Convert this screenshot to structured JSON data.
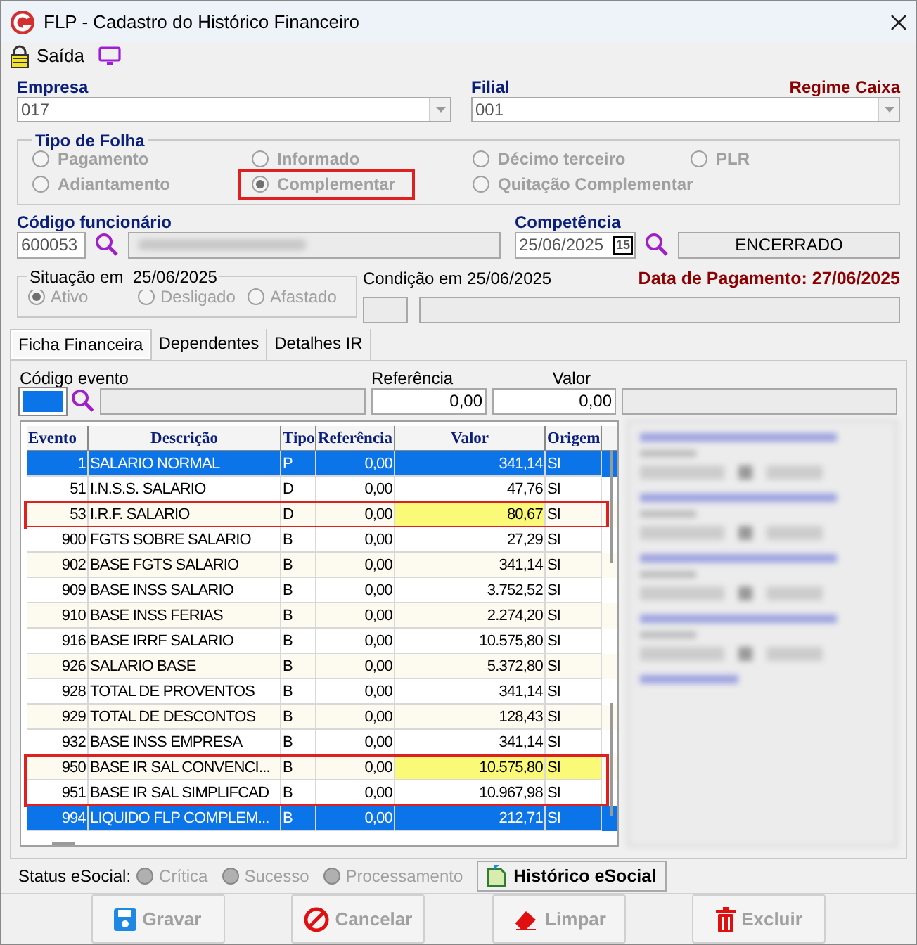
{
  "window": {
    "title": "FLP - Cadastro do Histórico Financeiro"
  },
  "toolbar": [
    {
      "kind": "lock",
      "label": "Saída"
    },
    {
      "kind": "monitor"
    }
  ],
  "empresa": {
    "label": "Empresa",
    "value": "017"
  },
  "filial": {
    "label": "Filial",
    "value": "001"
  },
  "regime": "Regime Caixa",
  "tipo_folha": {
    "title": "Tipo de Folha",
    "options": [
      {
        "label": "Pagamento",
        "selected": false,
        "outlined": false
      },
      {
        "label": "Informado",
        "selected": false,
        "outlined": false
      },
      {
        "label": "Décimo terceiro",
        "selected": false,
        "outlined": false
      },
      {
        "label": "PLR",
        "selected": false,
        "outlined": false
      },
      {
        "label": "Adiantamento",
        "selected": false,
        "outlined": false
      },
      {
        "label": "Complementar",
        "selected": true,
        "outlined": true
      },
      {
        "label": "Quitação Complementar",
        "selected": false,
        "outlined": false
      }
    ]
  },
  "funcionario": {
    "label": "Código funcionário",
    "code": "600053"
  },
  "competencia": {
    "label": "Competência",
    "value": "25/06/2025",
    "calendar": "15",
    "status": "ENCERRADO"
  },
  "situacao": {
    "title": "Situação em  25/06/2025",
    "options": [
      {
        "label": "Ativo",
        "selected": true
      },
      {
        "label": "Desligado",
        "selected": false
      },
      {
        "label": "Afastado",
        "selected": false
      }
    ]
  },
  "condicao": {
    "label": "Condição em 25/06/2025"
  },
  "pagamento": "Data de Pagamento: 27/06/2025",
  "tabs": [
    {
      "label": "Ficha Financeira",
      "selected": true
    },
    {
      "label": "Dependentes",
      "selected": false
    },
    {
      "label": "Detalhes IR",
      "selected": false
    }
  ],
  "evento": {
    "codigo_label": "Código evento",
    "referencia_label": "Referência",
    "referencia": "0,00",
    "valor_label": "Valor",
    "valor": "0,00"
  },
  "table": {
    "columns": [
      "Evento",
      "Descrição",
      "Tipo",
      "Referência",
      "Valor",
      "Origem"
    ],
    "rows": [
      {
        "cells": [
          "1",
          "SALARIO NORMAL",
          "P",
          "0,00",
          "341,14",
          "SI"
        ],
        "selected": true,
        "valor_highlighted": false,
        "origem_highlighted": false,
        "outlined": false
      },
      {
        "cells": [
          "51",
          "I.N.S.S. SALARIO",
          "D",
          "0,00",
          "47,76",
          "SI"
        ],
        "selected": false,
        "valor_highlighted": false,
        "origem_highlighted": false,
        "outlined": false
      },
      {
        "cells": [
          "53",
          "I.R.F. SALARIO",
          "D",
          "0,00",
          "80,67",
          "SI"
        ],
        "selected": false,
        "valor_highlighted": true,
        "origem_highlighted": false,
        "outlined": true
      },
      {
        "cells": [
          "900",
          "FGTS SOBRE SALARIO",
          "B",
          "0,00",
          "27,29",
          "SI"
        ],
        "selected": false,
        "valor_highlighted": false,
        "origem_highlighted": false,
        "outlined": false
      },
      {
        "cells": [
          "902",
          "BASE FGTS SALARIO",
          "B",
          "0,00",
          "341,14",
          "SI"
        ],
        "selected": false,
        "valor_highlighted": false,
        "origem_highlighted": false,
        "outlined": false
      },
      {
        "cells": [
          "909",
          "BASE INSS SALARIO",
          "B",
          "0,00",
          "3.752,52",
          "SI"
        ],
        "selected": false,
        "valor_highlighted": false,
        "origem_highlighted": false,
        "outlined": false
      },
      {
        "cells": [
          "910",
          "BASE INSS FERIAS",
          "B",
          "0,00",
          "2.274,20",
          "SI"
        ],
        "selected": false,
        "valor_highlighted": false,
        "origem_highlighted": false,
        "outlined": false
      },
      {
        "cells": [
          "916",
          "BASE IRRF SALARIO",
          "B",
          "0,00",
          "10.575,80",
          "SI"
        ],
        "selected": false,
        "valor_highlighted": false,
        "origem_highlighted": false,
        "outlined": false
      },
      {
        "cells": [
          "926",
          "SALARIO BASE",
          "B",
          "0,00",
          "5.372,80",
          "SI"
        ],
        "selected": false,
        "valor_highlighted": false,
        "origem_highlighted": false,
        "outlined": false
      },
      {
        "cells": [
          "928",
          "TOTAL DE PROVENTOS",
          "B",
          "0,00",
          "341,14",
          "SI"
        ],
        "selected": false,
        "valor_highlighted": false,
        "origem_highlighted": false,
        "outlined": false
      },
      {
        "cells": [
          "929",
          "TOTAL DE DESCONTOS",
          "B",
          "0,00",
          "128,43",
          "SI"
        ],
        "selected": false,
        "valor_highlighted": false,
        "origem_highlighted": false,
        "outlined": false
      },
      {
        "cells": [
          "932",
          "BASE INSS EMPRESA",
          "B",
          "0,00",
          "341,14",
          "SI"
        ],
        "selected": false,
        "valor_highlighted": false,
        "origem_highlighted": false,
        "outlined": false
      },
      {
        "cells": [
          "950",
          "BASE IR SAL CONVENCI...",
          "B",
          "0,00",
          "10.575,80",
          "SI"
        ],
        "selected": false,
        "valor_highlighted": true,
        "origem_highlighted": true,
        "outlined": true
      },
      {
        "cells": [
          "951",
          "BASE IR SAL SIMPLIFCAD",
          "B",
          "0,00",
          "10.967,98",
          "SI"
        ],
        "selected": false,
        "valor_highlighted": false,
        "origem_highlighted": false,
        "outlined": true
      },
      {
        "cells": [
          "994",
          "LIQUIDO FLP COMPLEM...",
          "B",
          "0,00",
          "212,71",
          "SI"
        ],
        "selected": true,
        "valor_highlighted": false,
        "origem_highlighted": false,
        "outlined": false
      }
    ]
  },
  "status": {
    "label": "Status eSocial:",
    "options": [
      "Crítica",
      "Sucesso",
      "Processamento"
    ],
    "history_button": "Histórico eSocial"
  },
  "buttons": [
    {
      "kind": "save",
      "label": "Gravar",
      "disabled": true
    },
    {
      "kind": "cancel",
      "label": "Cancelar",
      "disabled": true
    },
    {
      "kind": "clear",
      "label": "Limpar",
      "disabled": true
    },
    {
      "kind": "delete",
      "label": "Excluir",
      "disabled": true
    }
  ]
}
